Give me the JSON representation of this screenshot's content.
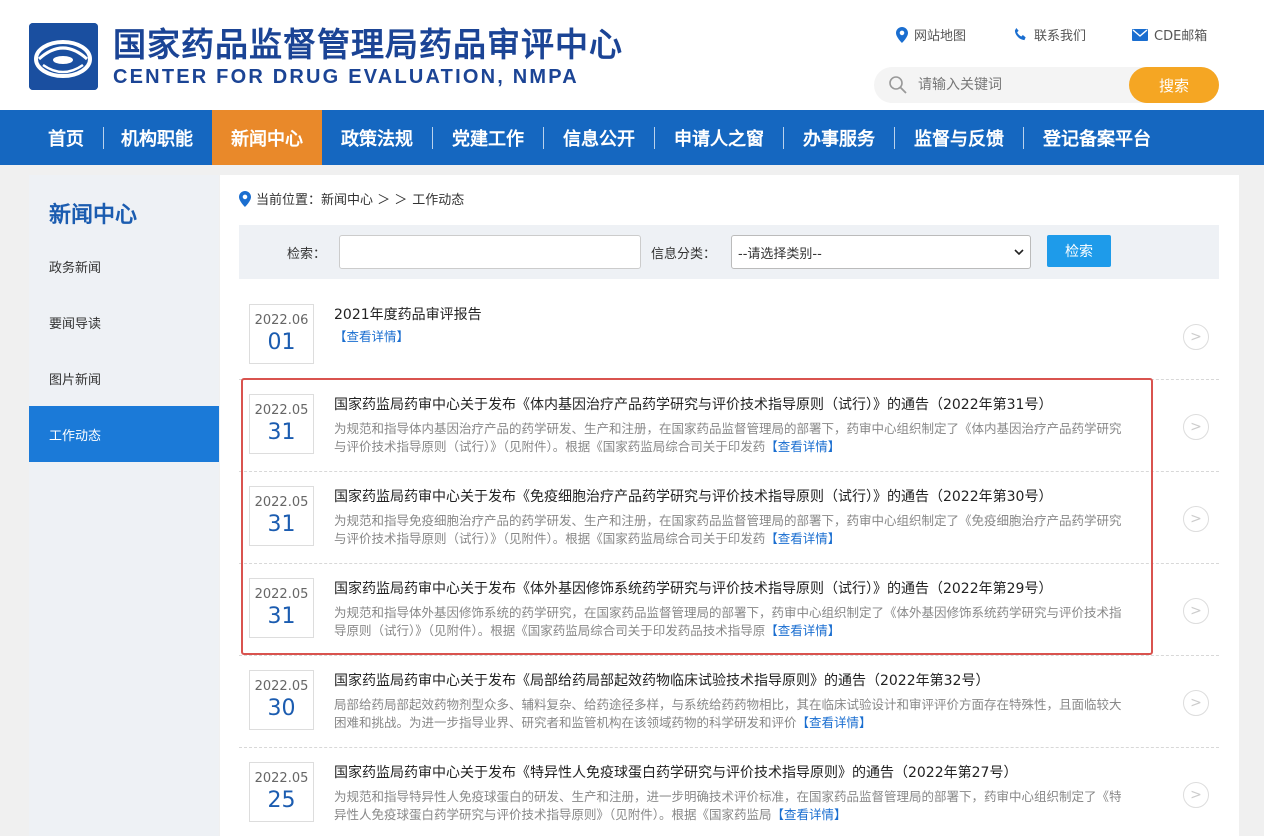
{
  "header": {
    "title": "国家药品监督管理局药品审评中心",
    "subtitle": "CENTER FOR DRUG EVALUATION, NMPA",
    "links": {
      "sitemap": "网站地图",
      "contact": "联系我们",
      "email": "CDE邮箱"
    },
    "search": {
      "placeholder": "请输入关键词",
      "button": "搜索"
    }
  },
  "nav": [
    "首页",
    "机构职能",
    "新闻中心",
    "政策法规",
    "党建工作",
    "信息公开",
    "申请人之窗",
    "办事服务",
    "监督与反馈",
    "登记备案平台"
  ],
  "sidebar": {
    "title": "新闻中心",
    "items": [
      "政务新闻",
      "要闻导读",
      "图片新闻",
      "工作动态"
    ]
  },
  "breadcrumb": {
    "prefix": "当前位置：新闻中心 ＞ ＞",
    "current": "工作动态"
  },
  "filter": {
    "keyword_label": "检索：",
    "category_label": "信息分类：",
    "category_value": "--请选择类别--",
    "button": "检索"
  },
  "news": [
    {
      "ym": "2022.06",
      "d": "01",
      "title": "2021年度药品审评报告",
      "summary": "",
      "more": "【查看详情】"
    },
    {
      "ym": "2022.05",
      "d": "31",
      "title": "国家药监局药审中心关于发布《体内基因治疗产品药学研究与评价技术指导原则（试行）》的通告（2022年第31号）",
      "summary": "为规范和指导体内基因治疗产品的药学研发、生产和注册，在国家药品监督管理局的部署下，药审中心组织制定了《体内基因治疗产品药学研究与评价技术指导原则（试行）》（见附件）。根据《国家药监局综合司关于印发药",
      "more": "【查看详情】"
    },
    {
      "ym": "2022.05",
      "d": "31",
      "title": "国家药监局药审中心关于发布《免疫细胞治疗产品药学研究与评价技术指导原则（试行）》的通告（2022年第30号）",
      "summary": "为规范和指导免疫细胞治疗产品的药学研发、生产和注册，在国家药品监督管理局的部署下，药审中心组织制定了《免疫细胞治疗产品药学研究与评价技术指导原则（试行）》（见附件）。根据《国家药监局综合司关于印发药",
      "more": "【查看详情】"
    },
    {
      "ym": "2022.05",
      "d": "31",
      "title": "国家药监局药审中心关于发布《体外基因修饰系统药学研究与评价技术指导原则（试行）》的通告（2022年第29号）",
      "summary": "为规范和指导体外基因修饰系统的药学研究，在国家药品监督管理局的部署下，药审中心组织制定了《体外基因修饰系统药学研究与评价技术指导原则（试行）》（见附件）。根据《国家药监局综合司关于印发药品技术指导原",
      "more": "【查看详情】"
    },
    {
      "ym": "2022.05",
      "d": "30",
      "title": "国家药监局药审中心关于发布《局部给药局部起效药物临床试验技术指导原则》的通告（2022年第32号）",
      "summary": "局部给药局部起效药物剂型众多、辅料复杂、给药途径多样，与系统给药药物相比，其在临床试验设计和审评评价方面存在特殊性，且面临较大困难和挑战。为进一步指导业界、研究者和监管机构在该领域药物的科学研发和评价",
      "more": "【查看详情】"
    },
    {
      "ym": "2022.05",
      "d": "25",
      "title": "国家药监局药审中心关于发布《特异性人免疫球蛋白药学研究与评价技术指导原则》的通告（2022年第27号）",
      "summary": "为规范和指导特异性人免疫球蛋白的研发、生产和注册，进一步明确技术评价标准，在国家药品监督管理局的部署下，药审中心组织制定了《特异性人免疫球蛋白药学研究与评价技术指导原则》（见附件）。根据《国家药监局",
      "more": "【查看详情】"
    }
  ],
  "colors": {
    "brand": "#1b4495",
    "nav": "#1567c0",
    "nav_active": "#e9892a",
    "search_button": "#f5a623",
    "link": "#1a6ed0",
    "highlight": "#d9534f"
  }
}
